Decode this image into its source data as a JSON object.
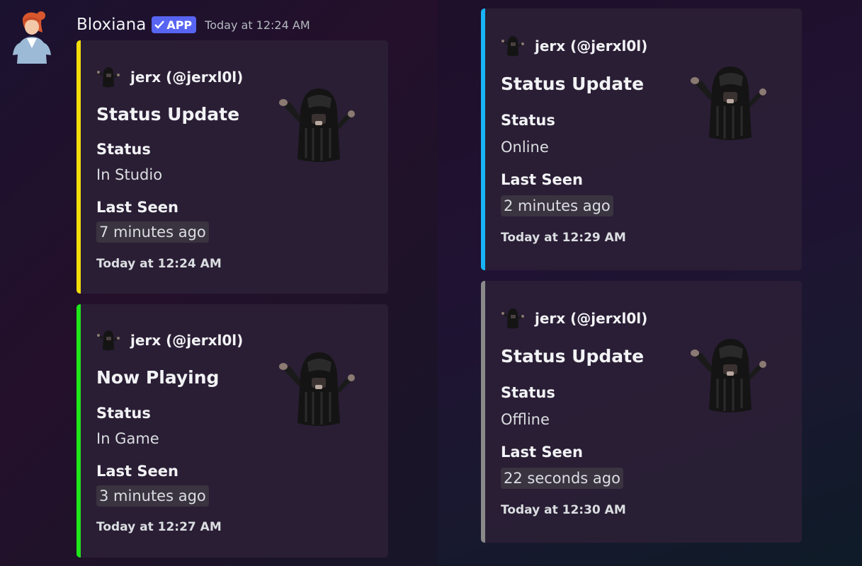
{
  "message": {
    "username": "Bloxiana",
    "badge": "APP",
    "timestamp": "Today at 12:24 AM"
  },
  "embeds": [
    {
      "accent": "#f5dd0a",
      "author": "jerx (@jerxl0l)",
      "title": "Status Update",
      "status_label": "Status",
      "status_value": "In Studio",
      "last_seen_label": "Last Seen",
      "last_seen_value": "7 minutes ago",
      "footer": "Today at 12:24 AM"
    },
    {
      "accent": "#1fe61b",
      "author": "jerx (@jerxl0l)",
      "title": "Now Playing",
      "status_label": "Status",
      "status_value": "In Game",
      "last_seen_label": "Last Seen",
      "last_seen_value": "3 minutes ago",
      "footer": "Today at 12:27 AM"
    },
    {
      "accent": "#18b4f5",
      "author": "jerx (@jerxl0l)",
      "title": "Status Update",
      "status_label": "Status",
      "status_value": "Online",
      "last_seen_label": "Last Seen",
      "last_seen_value": "2 minutes ago",
      "footer": "Today at 12:29 AM"
    },
    {
      "accent": "#8a8a8a",
      "author": "jerx (@jerxl0l)",
      "title": "Status Update",
      "status_label": "Status",
      "status_value": "Offline",
      "last_seen_label": "Last Seen",
      "last_seen_value": "22 seconds ago",
      "footer": "Today at 12:30 AM"
    }
  ],
  "icons": {
    "avatar": "bot-avatar",
    "badge_check": "checkmark-icon",
    "author": "roblox-avatar-icon",
    "thumbnail": "roblox-character-thumbnail"
  }
}
